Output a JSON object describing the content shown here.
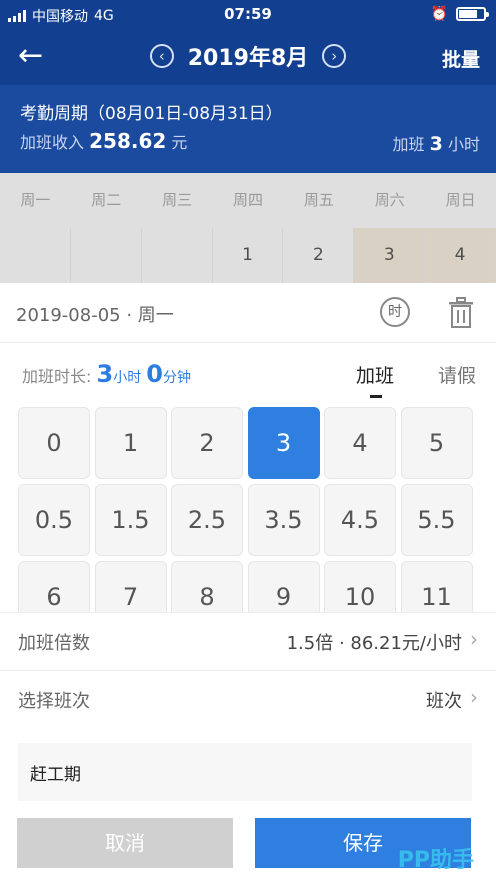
{
  "status": {
    "carrier": "中国移动",
    "network": "4G",
    "time": "07:59"
  },
  "nav": {
    "back": "←",
    "prev": "‹",
    "next": "›",
    "month": "2019年8月",
    "batch": "批量"
  },
  "period": {
    "title": "考勤周期（08月01日-08月31日）",
    "income_label": "加班收入",
    "income_value": "258.62",
    "income_unit": "元",
    "ot_label": "加班",
    "ot_value": "3",
    "ot_unit": "小时"
  },
  "calendar": {
    "weekdays": [
      "周一",
      "周二",
      "周三",
      "周四",
      "周五",
      "周六",
      "周日"
    ],
    "days": [
      "",
      "",
      "",
      "1",
      "2",
      "3",
      "4"
    ]
  },
  "sheet": {
    "date": "2019-08-05 · 周一",
    "clock_glyph": "时",
    "duration_label": "加班时长:",
    "hours": "3",
    "hours_unit": "小时",
    "minutes": "0",
    "minutes_unit": "分钟",
    "tab_overtime": "加班",
    "tab_leave": "请假",
    "numbers": [
      "0",
      "1",
      "2",
      "3",
      "4",
      "5",
      "0.5",
      "1.5",
      "2.5",
      "3.5",
      "4.5",
      "5.5",
      "6",
      "7",
      "8",
      "9",
      "10",
      "11"
    ],
    "selected": "3",
    "multiplier_label": "加班倍数",
    "multiplier_value": "1.5倍 · 86.21元/小时",
    "shift_label": "选择班次",
    "shift_value": "班次",
    "chevron": "›",
    "remark": "赶工期",
    "cancel": "取消",
    "save": "保存"
  },
  "watermark": "PP助手",
  "colors": {
    "header": "#123f8f",
    "accent": "#2f7fe0"
  }
}
